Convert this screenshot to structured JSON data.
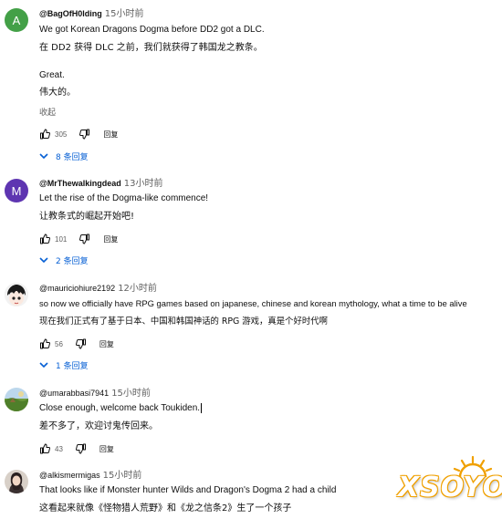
{
  "comments": [
    {
      "avatar_letter": "A",
      "avatar_color": "#43a047",
      "author": "@BagOfH0lding",
      "time": "15小时前",
      "lines": [
        "We got Korean Dragons Dogma before DD2 got a DLC."
      ],
      "zh_lines": [
        "在 DD2 获得 DLC 之前，我们就获得了韩国龙之教条。"
      ],
      "extra_lines": [
        "Great."
      ],
      "extra_zh": [
        "伟大的。"
      ],
      "collapse": "收起",
      "likes": "305",
      "reply_label": "回复",
      "replies_label": "8 条回复"
    },
    {
      "avatar_letter": "M",
      "avatar_color": "#5e35b1",
      "author": "@MrThewalkingdead",
      "time": "13小时前",
      "lines": [
        "Let the rise of the Dogma-like commence!"
      ],
      "zh_lines": [
        "让教条式的崛起开始吧!"
      ],
      "likes": "101",
      "reply_label": "回复",
      "replies_label": "2 条回复"
    },
    {
      "avatar_icon": "anime-avatar-icon",
      "author": "@mauriciohiure2192",
      "time": "12小时前",
      "lines": [
        "so now we officially have RPG games based on japanese, chinese and korean mythology, what a time to be alive"
      ],
      "zh_lines": [
        "现在我们正式有了基于日本、中国和韩国神话的 RPG 游戏，真是个好时代啊"
      ],
      "likes": "56",
      "reply_label": "回复",
      "replies_label": "1 条回复"
    },
    {
      "avatar_icon": "landscape-avatar-icon",
      "author": "@umarabbasi7941",
      "time": "15小时前",
      "lines": [
        "Close enough, welcome back Toukiden."
      ],
      "zh_lines": [
        "差不多了，欢迎讨鬼传回来。"
      ],
      "likes": "43",
      "reply_label": "回复"
    },
    {
      "avatar_icon": "portrait-avatar-icon",
      "author": "@alkismermigas",
      "time": "15小时前",
      "lines": [
        "That looks like if Monster hunter Wilds and Dragon's Dogma 2 had a child"
      ],
      "zh_lines": [
        "这看起来就像《怪物猎人荒野》和《龙之信条2》生了一个孩子"
      ]
    }
  ],
  "watermark": "XSOYO"
}
